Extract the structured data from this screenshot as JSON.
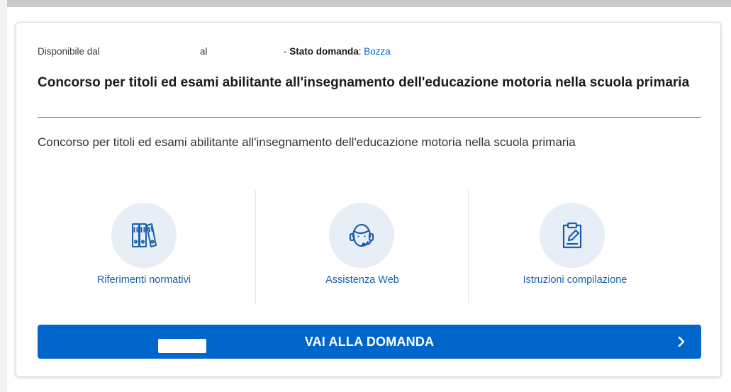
{
  "card": {
    "available_label": "Disponibile dal",
    "until_label": "al",
    "status_prefix": "- ",
    "status_label": "Stato domanda",
    "status_sep": ":",
    "status_value": "Bozza",
    "title": "Concorso per titoli ed esami abilitante all'insegnamento dell'educazione motoria nella scuola primaria",
    "description": "Concorso per titoli ed esami abilitante all'insegnamento dell'educazione motoria nella scuola primaria"
  },
  "links": [
    {
      "label": "Riferimenti normativi",
      "icon": "binders-icon"
    },
    {
      "label": "Assistenza Web",
      "icon": "headset-support-icon"
    },
    {
      "label": "Istruzioni compilazione",
      "icon": "clipboard-edit-icon"
    }
  ],
  "cta": {
    "label": "VAI ALLA DOMANDA",
    "icon": "chevron-right-icon"
  },
  "colors": {
    "primary": "#0066cc",
    "link": "#1b5fa8",
    "icon_circle": "#e7eef6",
    "divider": "#29a3b8"
  }
}
